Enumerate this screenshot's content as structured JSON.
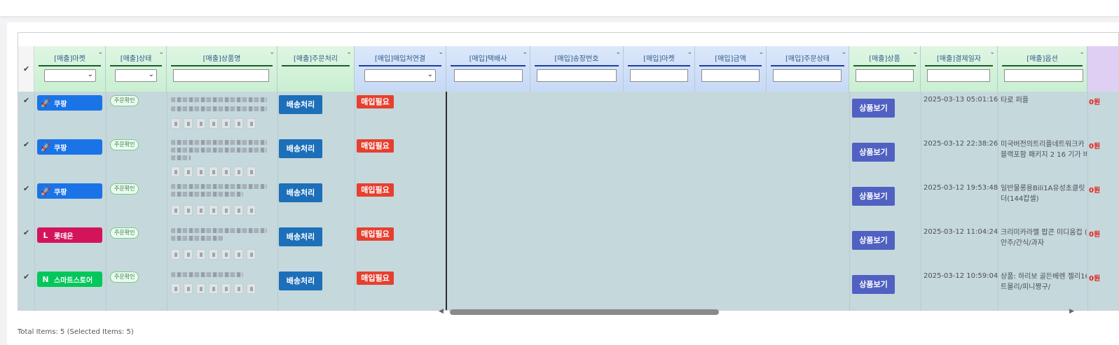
{
  "columns": [
    {
      "label": "[매출]마켓"
    },
    {
      "label": "[매출]상태"
    },
    {
      "label": "[매출]상품명"
    },
    {
      "label": "[매출]주문처리"
    },
    {
      "label": "[매입]매입처연결"
    },
    {
      "label": "[매입]택배사"
    },
    {
      "label": "[매입]송장번호"
    },
    {
      "label": "[매입]마켓"
    },
    {
      "label": "[매입]금액"
    },
    {
      "label": "[매입]주문상태"
    },
    {
      "label": "[매출]상품"
    },
    {
      "label": "[매출]결제일자"
    },
    {
      "label": "[매출]옵션"
    }
  ],
  "rows": [
    {
      "market": "쿠팡",
      "market_icon": "rocket-icon",
      "market_glyph": "🚀",
      "status": "주문확인",
      "ship": "배송처리",
      "buy": "매입필요",
      "product_btn": "상품보기",
      "date": "2025-03-13 05:01:16",
      "option_lines": [
        "타로 퍼플"
      ],
      "edge": "0원"
    },
    {
      "market": "쿠팡",
      "market_icon": "rocket-icon",
      "market_glyph": "🚀",
      "status": "주문확인",
      "ship": "배송처리",
      "buy": "매입필요",
      "product_btn": "상품보기",
      "date": "2025-03-12 22:38:26",
      "option_lines": [
        "미국버전의트리플네트워크카",
        "블랙포함 패키지 2 16 기가 바"
      ],
      "edge": "0원"
    },
    {
      "market": "쿠팡",
      "market_icon": "rocket-icon",
      "market_glyph": "🚀",
      "status": "주문확인",
      "ship": "배송처리",
      "buy": "매입필요",
      "product_btn": "상품보기",
      "date": "2025-03-12 19:53:48",
      "option_lines": [
        "일반물롱용Bili1A유성초클릿",
        "더(144캅셀)"
      ],
      "edge": "0원"
    },
    {
      "market": "롯데온",
      "market_icon": "lotte-l-icon",
      "market_glyph": "L",
      "status": "주문확인",
      "ship": "배송처리",
      "buy": "매입필요",
      "product_btn": "상품보기",
      "date": "2025-03-12 11:04:24",
      "option_lines": [
        "크리미카라멜 팝콘 미디움컵 (",
        "안주/간식/과자"
      ],
      "edge": "0원"
    },
    {
      "market": "스마트스토어",
      "market_icon": "naver-n-icon",
      "market_glyph": "N",
      "status": "주문확인",
      "ship": "배송처리",
      "buy": "매입필요",
      "product_btn": "상품보기",
      "date": "2025-03-12 10:59:04",
      "option_lines": [
        "상품: 하리보 골든베렌 젤리16",
        "트몰리/피니짱구/"
      ],
      "edge": "0원"
    }
  ],
  "footer": {
    "text": "Total Items: 5 (Selected Items: 5)"
  },
  "colors": {
    "coupang": "#1a74e8",
    "lotte": "#d4145a",
    "smartstore": "#03c75a",
    "ship_button": "#1c6fb8",
    "buy_badge": "#e5402f",
    "product_button": "#5061c2"
  }
}
